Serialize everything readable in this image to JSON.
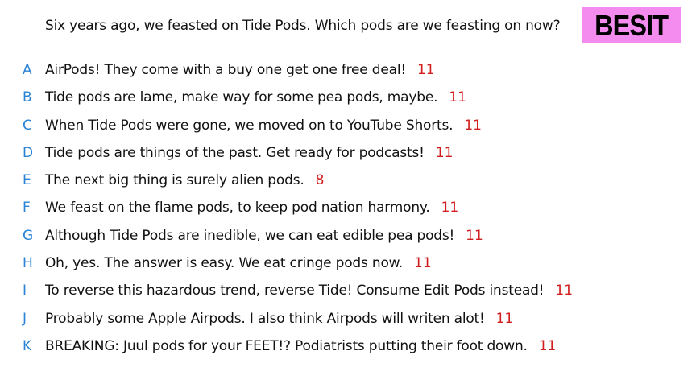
{
  "question": "Six years ago, we feasted on Tide Pods. Which pods are we feasting on now?",
  "badge": "BESIT",
  "colors": {
    "letter": "#2a83d6",
    "score": "#d11e1e",
    "badge_bg": "#f48cf0"
  },
  "answers": [
    {
      "letter": "A",
      "text": "AirPods! They come with a buy one get one free deal!",
      "score": "11"
    },
    {
      "letter": "B",
      "text": "Tide pods are lame, make way for some pea pods, maybe.",
      "score": "11"
    },
    {
      "letter": "C",
      "text": "When Tide Pods were gone, we moved on to YouTube Shorts.",
      "score": "11"
    },
    {
      "letter": "D",
      "text": "Tide pods are things of the past. Get ready for podcasts!",
      "score": "11"
    },
    {
      "letter": "E",
      "text": "The next big thing is surely alien pods.",
      "score": "8"
    },
    {
      "letter": "F",
      "text": "We feast on the flame pods, to keep pod nation harmony.",
      "score": "11"
    },
    {
      "letter": "G",
      "text": "Although Tide Pods are inedible, we can eat edible pea pods!",
      "score": "11"
    },
    {
      "letter": "H",
      "text": "Oh, yes. The answer is easy. We eat cringe pods now.",
      "score": "11"
    },
    {
      "letter": "I",
      "text": "To reverse this hazardous trend, reverse Tide! Consume Edit Pods instead!",
      "score": "11"
    },
    {
      "letter": "J",
      "text": "Probably some Apple Airpods. I also think Airpods will writen alot!",
      "score": "11"
    },
    {
      "letter": "K",
      "text": "BREAKING: Juul pods for your FEET!? Podiatrists putting their foot down.",
      "score": "11"
    }
  ]
}
